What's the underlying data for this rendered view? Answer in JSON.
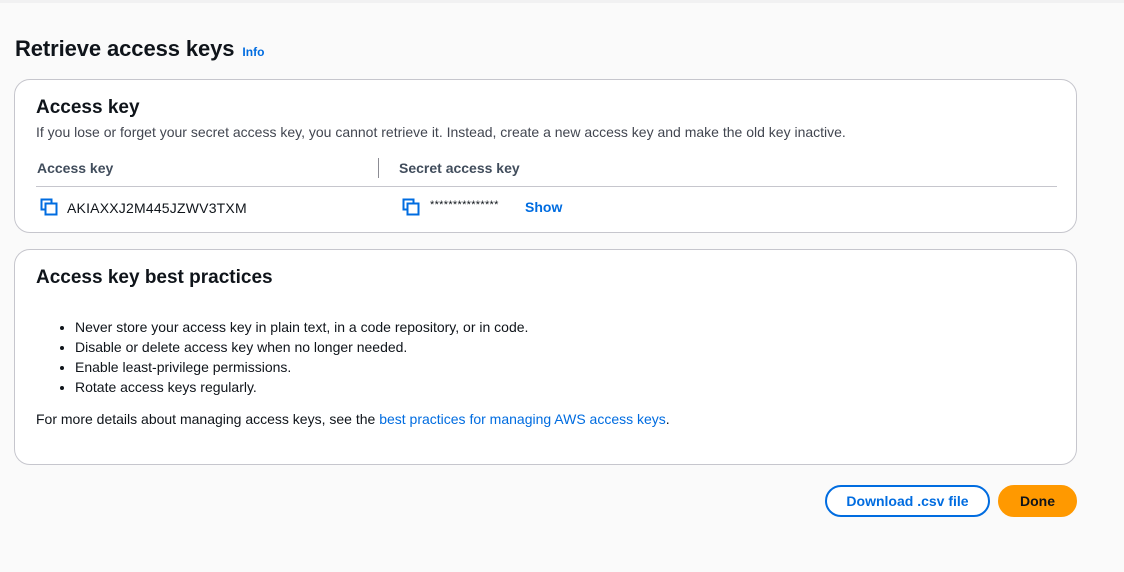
{
  "header": {
    "title": "Retrieve access keys",
    "info_label": "Info"
  },
  "access_key_card": {
    "title": "Access key",
    "description": "If you lose or forget your secret access key, you cannot retrieve it. Instead, create a new access key and make the old key inactive.",
    "columns": [
      "Access key",
      "Secret access key"
    ],
    "access_key_value": "AKIAXXJ2M445JZWV3TXM",
    "secret_masked": "***************",
    "show_label": "Show",
    "icons": {
      "copy": "copy-icon"
    }
  },
  "best_practices_card": {
    "title": "Access key best practices",
    "items": [
      "Never store your access key in plain text, in a code repository, or in code.",
      "Disable or delete access key when no longer needed.",
      "Enable least-privilege permissions.",
      "Rotate access keys regularly."
    ],
    "footer_prefix": "For more details about managing access keys, see the ",
    "footer_link": "best practices for managing AWS access keys",
    "footer_suffix": "."
  },
  "actions": {
    "download_label": "Download .csv file",
    "done_label": "Done"
  },
  "colors": {
    "link": "#006ce0",
    "primary_button": "#ff9900",
    "card_border": "#c6c6cd",
    "background": "#fafafa"
  }
}
